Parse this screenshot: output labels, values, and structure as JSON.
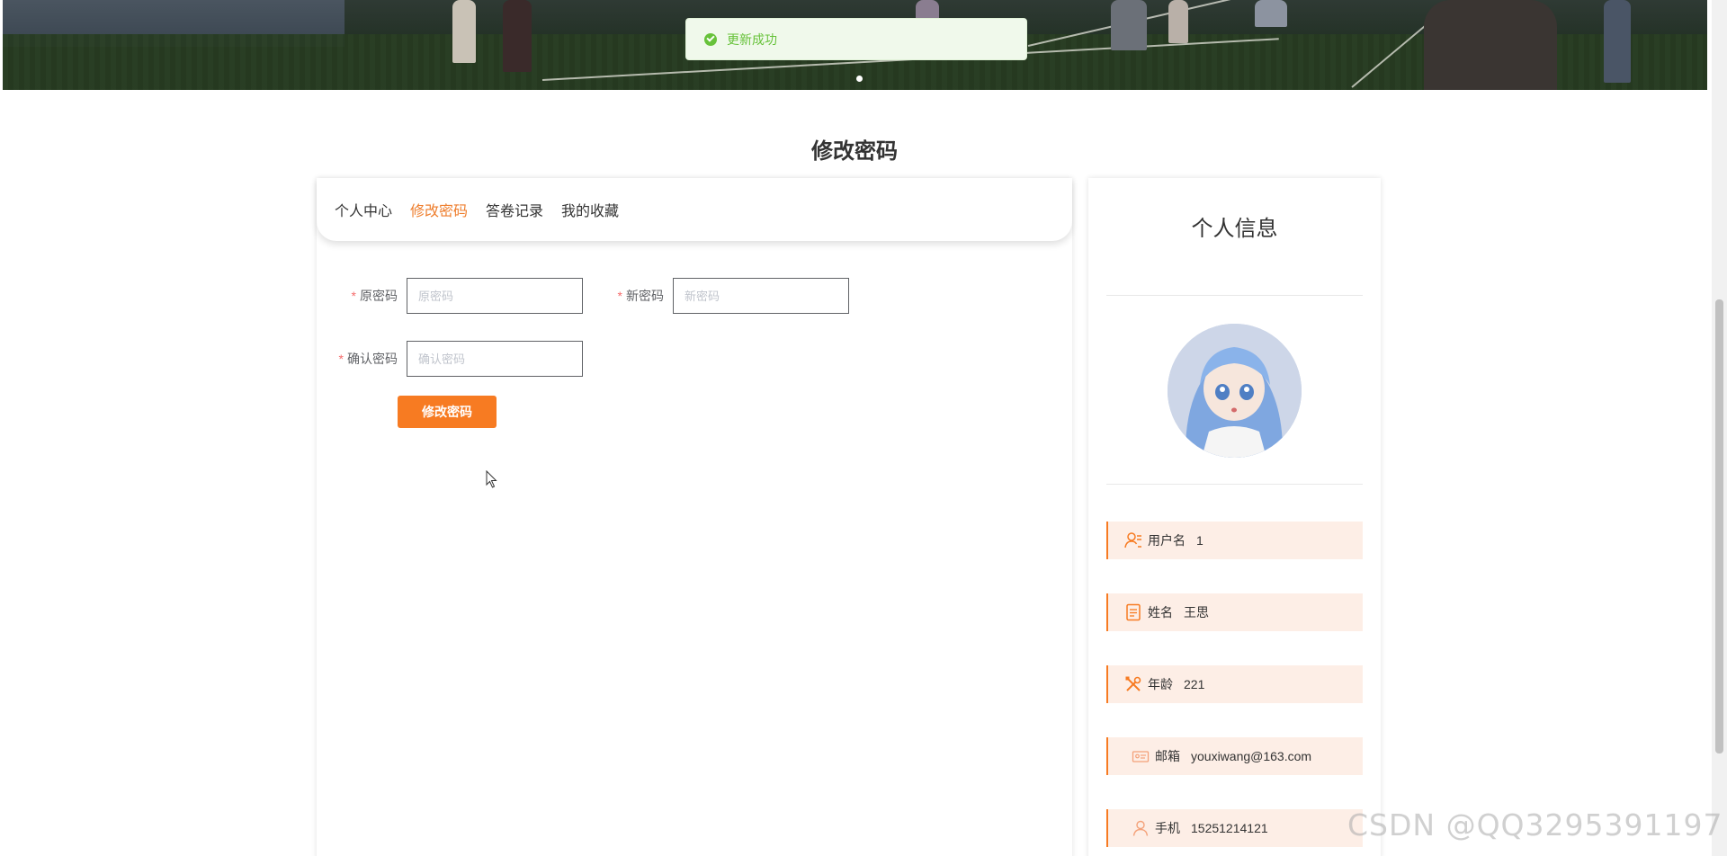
{
  "toast": {
    "message": "更新成功",
    "color": "#67c23a"
  },
  "page": {
    "title": "修改密码"
  },
  "tabs": [
    {
      "label": "个人中心",
      "active": false
    },
    {
      "label": "修改密码",
      "active": true
    },
    {
      "label": "答卷记录",
      "active": false
    },
    {
      "label": "我的收藏",
      "active": false
    }
  ],
  "form": {
    "old_password": {
      "label": "原密码",
      "placeholder": "原密码",
      "value": ""
    },
    "new_password": {
      "label": "新密码",
      "placeholder": "新密码",
      "value": ""
    },
    "confirm_password": {
      "label": "确认密码",
      "placeholder": "确认密码",
      "value": ""
    },
    "required_mark": "*",
    "submit_label": "修改密码"
  },
  "profile": {
    "title": "个人信息",
    "fields": [
      {
        "icon": "user-id-icon",
        "label": "用户名",
        "value": "1"
      },
      {
        "icon": "document-icon",
        "label": "姓名",
        "value": "王思"
      },
      {
        "icon": "tools-icon",
        "label": "年龄",
        "value": "221"
      },
      {
        "icon": "id-card-icon",
        "label": "邮箱",
        "value": "youxiwang@163.com"
      },
      {
        "icon": "person-icon",
        "label": "手机",
        "value": "15251214121"
      }
    ]
  },
  "watermark": "CSDN @QQ3295391197",
  "colors": {
    "accent": "#f77b22",
    "active_tab": "#ee7d2c",
    "info_bg": "#fdeee6"
  }
}
